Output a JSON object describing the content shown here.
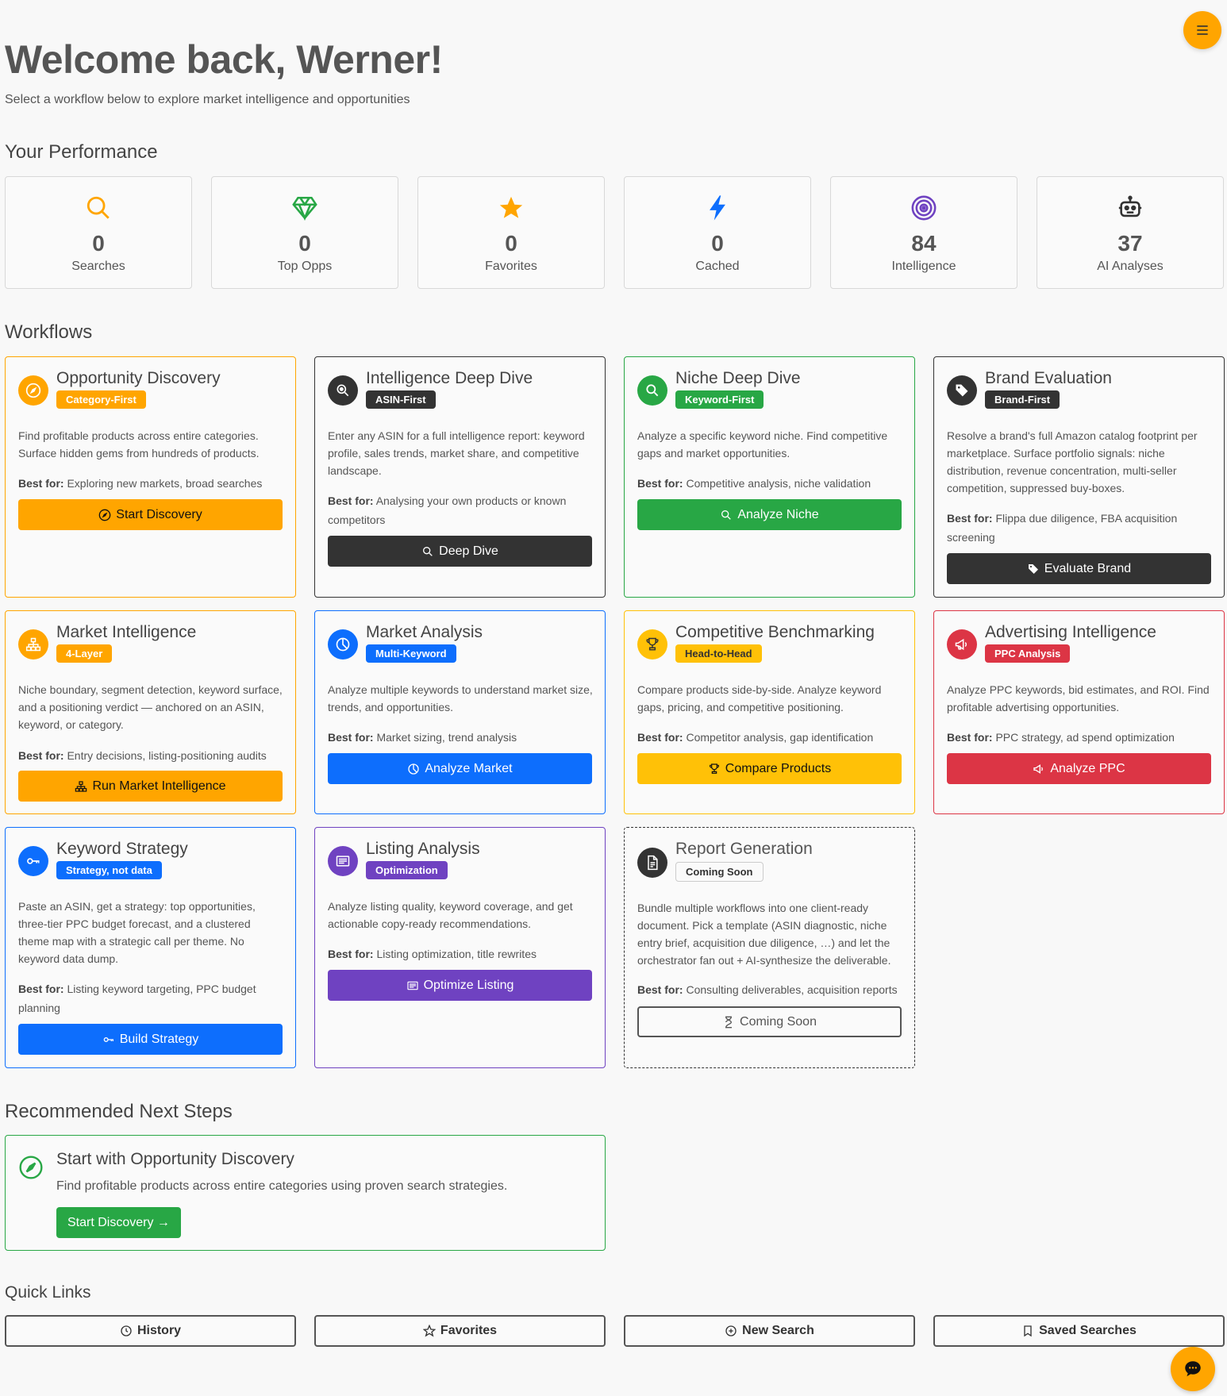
{
  "header": {
    "welcome": "Welcome back, Werner!",
    "subtitle": "Select a workflow below to explore market intelligence and opportunities"
  },
  "performance": {
    "title": "Your Performance",
    "stats": [
      {
        "icon": "search-icon",
        "value": "0",
        "label": "Searches",
        "color": "#ffa500"
      },
      {
        "icon": "gem-icon",
        "value": "0",
        "label": "Top Opps",
        "color": "#28a745"
      },
      {
        "icon": "star-icon",
        "value": "0",
        "label": "Favorites",
        "color": "#ffa500"
      },
      {
        "icon": "lightning-icon",
        "value": "0",
        "label": "Cached",
        "color": "#0d6efd"
      },
      {
        "icon": "target-icon",
        "value": "84",
        "label": "Intelligence",
        "color": "#6f42c1"
      },
      {
        "icon": "robot-icon",
        "value": "37",
        "label": "AI Analyses",
        "color": "#333333"
      }
    ]
  },
  "workflows": {
    "title": "Workflows",
    "cards": [
      {
        "title": "Opportunity Discovery",
        "tag": "Category-First",
        "desc": "Find profitable products across entire categories. Surface hidden gems from hundreds of products.",
        "best_label": "Best for:",
        "best": "Exploring new markets, broad searches",
        "button": "Start Discovery",
        "color": "#ffa500"
      },
      {
        "title": "Intelligence Deep Dive",
        "tag": "ASIN-First",
        "desc": "Enter any ASIN for a full intelligence report: keyword profile, sales trends, market share, and competitive landscape.",
        "best_label": "Best for:",
        "best": "Analysing your own products or known competitors",
        "button": "Deep Dive",
        "color": "#333333"
      },
      {
        "title": "Niche Deep Dive",
        "tag": "Keyword-First",
        "desc": "Analyze a specific keyword niche. Find competitive gaps and market opportunities.",
        "best_label": "Best for:",
        "best": "Competitive analysis, niche validation",
        "button": "Analyze Niche",
        "color": "#28a745"
      },
      {
        "title": "Brand Evaluation",
        "tag": "Brand-First",
        "desc": "Resolve a brand's full Amazon catalog footprint per marketplace. Surface portfolio signals: niche distribution, revenue concentration, multi-seller competition, suppressed buy-boxes.",
        "best_label": "Best for:",
        "best": "Flippa due diligence, FBA acquisition screening",
        "button": "Evaluate Brand",
        "color": "#333333"
      },
      {
        "title": "Market Intelligence",
        "tag": "4-Layer",
        "desc": "Niche boundary, segment detection, keyword surface, and a positioning verdict — anchored on an ASIN, keyword, or category.",
        "best_label": "Best for:",
        "best": "Entry decisions, listing-positioning audits",
        "button": "Run Market Intelligence",
        "color": "#ffa500"
      },
      {
        "title": "Market Analysis",
        "tag": "Multi-Keyword",
        "desc": "Analyze multiple keywords to understand market size, trends, and opportunities.",
        "best_label": "Best for:",
        "best": "Market sizing, trend analysis",
        "button": "Analyze Market",
        "color": "#0d6efd"
      },
      {
        "title": "Competitive Benchmarking",
        "tag": "Head-to-Head",
        "desc": "Compare products side-by-side. Analyze keyword gaps, pricing, and competitive positioning.",
        "best_label": "Best for:",
        "best": "Competitor analysis, gap identification",
        "button": "Compare Products",
        "color": "#ffc107"
      },
      {
        "title": "Advertising Intelligence",
        "tag": "PPC Analysis",
        "desc": "Analyze PPC keywords, bid estimates, and ROI. Find profitable advertising opportunities.",
        "best_label": "Best for:",
        "best": "PPC strategy, ad spend optimization",
        "button": "Analyze PPC",
        "color": "#dc3545"
      },
      {
        "title": "Keyword Strategy",
        "tag": "Strategy, not data",
        "desc": "Paste an ASIN, get a strategy: top opportunities, three-tier PPC budget forecast, and a clustered theme map with a strategic call per theme. No keyword data dump.",
        "best_label": "Best for:",
        "best": "Listing keyword targeting, PPC budget planning",
        "button": "Build Strategy",
        "color": "#0d6efd"
      },
      {
        "title": "Listing Analysis",
        "tag": "Optimization",
        "desc": "Analyze listing quality, keyword coverage, and get actionable copy-ready recommendations.",
        "best_label": "Best for:",
        "best": "Listing optimization, title rewrites",
        "button": "Optimize Listing",
        "color": "#6f42c1"
      },
      {
        "title": "Report Generation",
        "tag": "Coming Soon",
        "desc": "Bundle multiple workflows into one client-ready document. Pick a template (ASIN diagnostic, niche entry brief, acquisition due diligence, …) and let the orchestrator fan out + AI-synthesize the deliverable.",
        "best_label": "Best for:",
        "best": "Consulting deliverables, acquisition reports",
        "button": "Coming Soon",
        "color": "#333333"
      }
    ]
  },
  "recommended": {
    "title": "Recommended Next Steps",
    "card_title": "Start with Opportunity Discovery",
    "card_desc": "Find profitable products across entire categories using proven search strategies.",
    "button": "Start Discovery →",
    "color": "#28a745"
  },
  "quick_links": {
    "title": "Quick Links",
    "items": [
      "History",
      "Favorites",
      "New Search",
      "Saved Searches"
    ]
  }
}
